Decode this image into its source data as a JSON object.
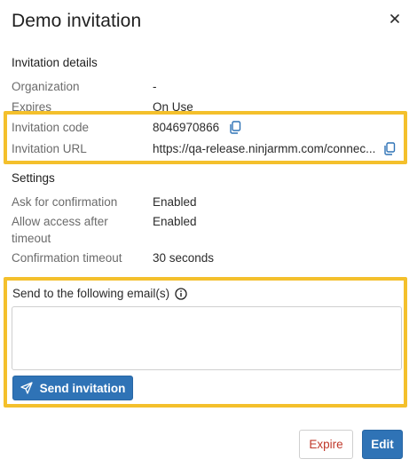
{
  "dialog": {
    "title": "Demo invitation"
  },
  "details": {
    "heading": "Invitation details",
    "rows": [
      {
        "label": "Organization",
        "value": "-"
      },
      {
        "label": "Expires",
        "value": "On Use"
      },
      {
        "label": "Invitation code",
        "value": "8046970866"
      },
      {
        "label": "Invitation URL",
        "value": "https://qa-release.ninjarmm.com/connec..."
      }
    ]
  },
  "settings": {
    "heading": "Settings",
    "rows": [
      {
        "label": "Ask for confirmation",
        "value": "Enabled"
      },
      {
        "label_line1": "Allow access after",
        "label_line2": "timeout",
        "value": "Enabled"
      },
      {
        "label": "Confirmation timeout",
        "value": "30 seconds"
      }
    ]
  },
  "email": {
    "label": "Send to the following email(s)",
    "value": "",
    "placeholder": "",
    "send_label": "Send invitation"
  },
  "footer": {
    "expire_label": "Expire",
    "edit_label": "Edit"
  },
  "colors": {
    "primary": "#2f73b6",
    "danger": "#c0392b",
    "highlight": "#f4c02c"
  },
  "icons": [
    "close-icon",
    "copy-icon",
    "info-icon",
    "send-icon"
  ]
}
